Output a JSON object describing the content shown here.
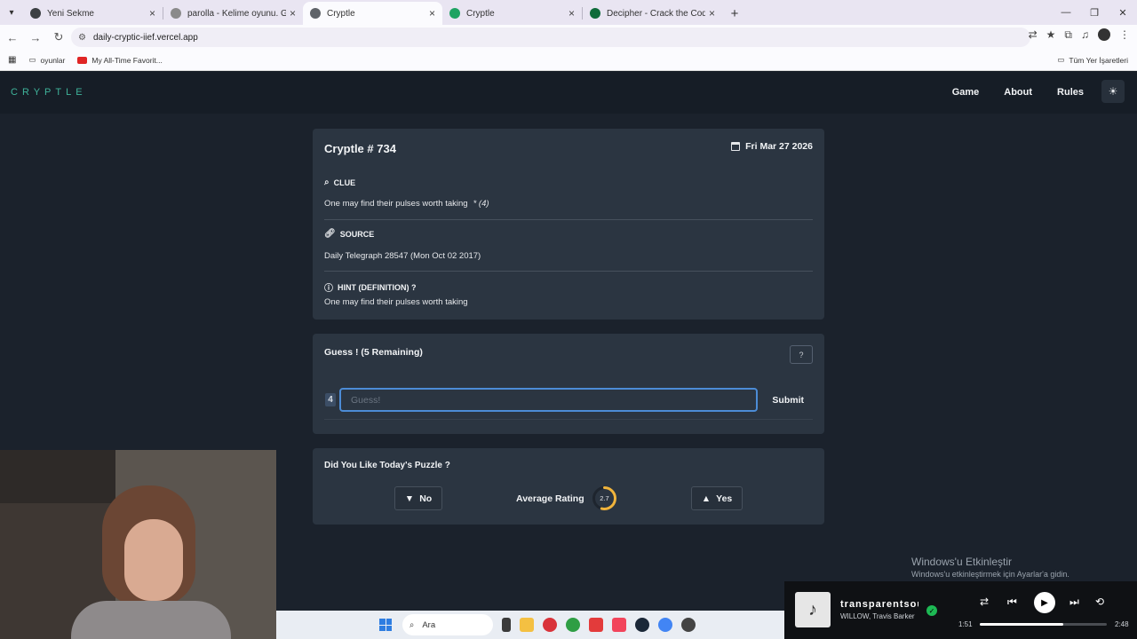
{
  "browser": {
    "tabs": [
      {
        "title": "Yeni Sekme",
        "favicon_color": "#3c4043",
        "active": false
      },
      {
        "title": "parolla - Kelime oyunu. Günlük",
        "favicon_color": "#8a8a8a",
        "active": false
      },
      {
        "title": "Cryptle",
        "favicon_color": "#5f6368",
        "active": true
      },
      {
        "title": "Cryptle",
        "favicon_color": "#1ea362",
        "active": false
      },
      {
        "title": "Decipher - Crack the Code, Rev",
        "favicon_color": "#0f6b3a",
        "active": false
      }
    ],
    "url": "daily-cryptic-iief.vercel.app",
    "bookmarks": [
      {
        "label": "oyunlar"
      },
      {
        "label": "My All-Time Favorit..."
      }
    ],
    "all_bookmarks_label": "Tüm Yer İşaretleri"
  },
  "site": {
    "logo": "CRYPTLE",
    "nav": [
      "Game",
      "About",
      "Rules"
    ]
  },
  "puzzle": {
    "title": "Cryptle # 734",
    "date": "Fri Mar 27 2026",
    "clue_label": "CLUE",
    "clue_text": "One may find their pulses worth taking",
    "clue_enum": "* (4)",
    "source_label": "SOURCE",
    "source_text": "Daily Telegraph 28547 (Mon Oct 02 2017)",
    "hint_label": "HINT (DEFINITION) ?",
    "hint_text": "One may find their pulses worth taking"
  },
  "guess": {
    "title": "Guess ! (5 Remaining)",
    "length": "4",
    "placeholder": "Guess!",
    "submit_label": "Submit"
  },
  "rating": {
    "title": "Did You Like Today's Puzzle ?",
    "no_label": "No",
    "yes_label": "Yes",
    "avg_label": "Average Rating",
    "avg_value": "2.7",
    "avg_fraction": 0.54
  },
  "taskbar": {
    "search_label": "Ara"
  },
  "activation": {
    "title": "Windows'u Etkinleştir",
    "subtitle": "Windows'u etkinleştirmek için Ayarlar'a gidin."
  },
  "media": {
    "track": "transparentsoul",
    "artist": "WILLOW, Travis Barker",
    "elapsed": "1:51",
    "duration": "2:48",
    "progress_fraction": 0.66
  },
  "colors": {
    "accent": "#3fb39a",
    "input_focus": "#4c8cd6",
    "rating_ring": "#f0b43c"
  }
}
